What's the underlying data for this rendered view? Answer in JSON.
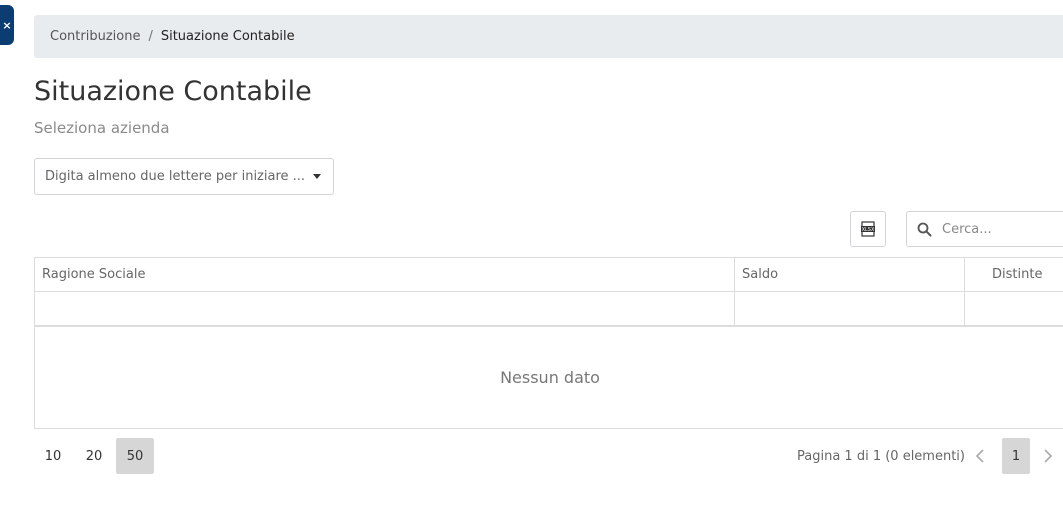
{
  "panel": {
    "close_label": "×"
  },
  "breadcrumb": {
    "parent": "Contribuzione",
    "separator": "/",
    "current": "Situazione Contabile"
  },
  "header": {
    "title": "Situazione Contabile",
    "subtitle": "Seleziona azienda"
  },
  "company_select": {
    "placeholder": "Digita almeno due lettere per iniziare ..."
  },
  "toolbar": {
    "export_icon": "xlsx-export-icon",
    "search_placeholder": "Cerca..."
  },
  "grid": {
    "columns": [
      "Ragione Sociale",
      "Saldo",
      "Distinte"
    ],
    "rows": [],
    "empty_text": "Nessun dato"
  },
  "pager": {
    "page_sizes": [
      "10",
      "20",
      "50"
    ],
    "selected_page_size": "50",
    "info": "Pagina 1 di 1 (0 elementi)",
    "pages": [
      "1"
    ],
    "current_page": "1"
  },
  "colors": {
    "accent": "#0b3d72",
    "breadcrumb_bg": "#e9ecef",
    "selected_bg": "#d6d6d6"
  }
}
